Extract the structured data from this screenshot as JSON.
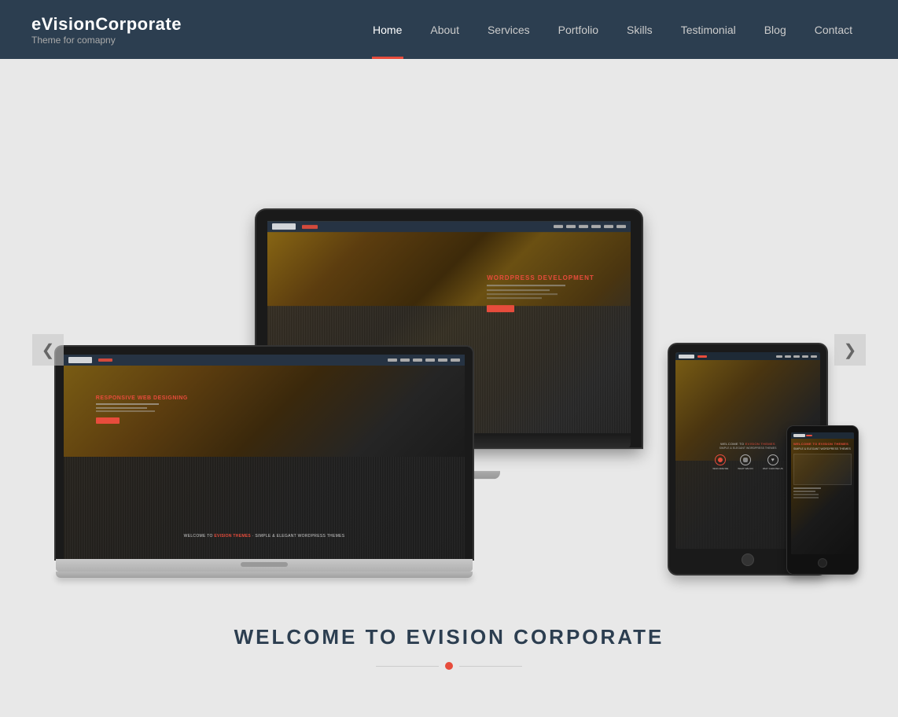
{
  "header": {
    "logo": {
      "title": "eVisionCorporate",
      "subtitle": "Theme for comapny"
    },
    "nav": {
      "items": [
        {
          "label": "Home",
          "active": true
        },
        {
          "label": "About",
          "active": false
        },
        {
          "label": "Services",
          "active": false
        },
        {
          "label": "Portfolio",
          "active": false
        },
        {
          "label": "Skills",
          "active": false
        },
        {
          "label": "Testimonial",
          "active": false
        },
        {
          "label": "Blog",
          "active": false
        },
        {
          "label": "Contact",
          "active": false
        }
      ]
    }
  },
  "main": {
    "carousel": {
      "left_arrow": "❮",
      "right_arrow": "❯"
    },
    "welcome": {
      "title": "WELCOME TO EVISION CORPORATE"
    }
  }
}
